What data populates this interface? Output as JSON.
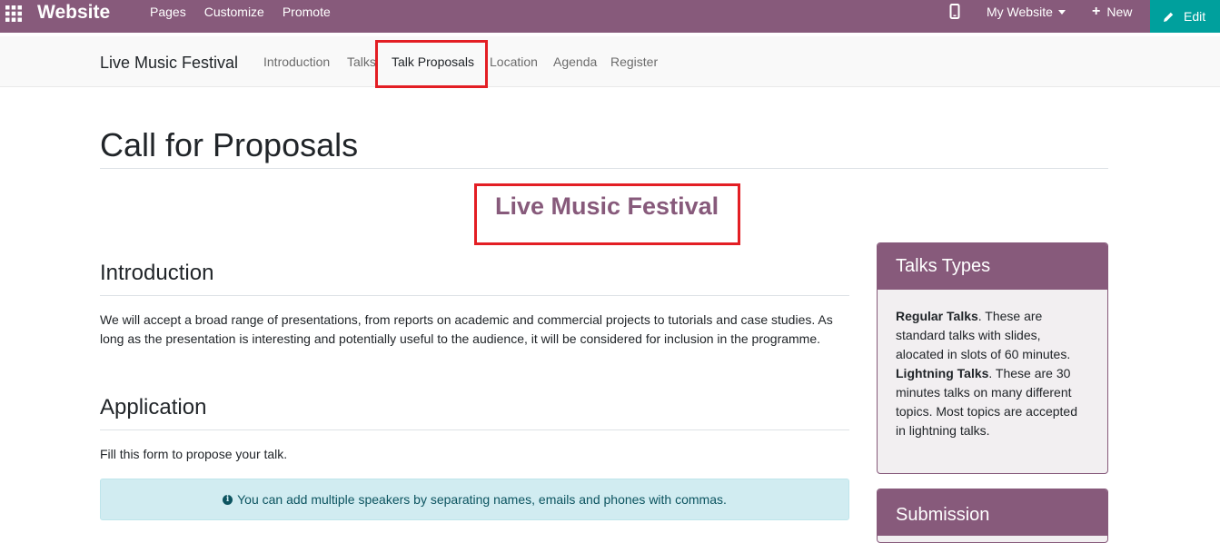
{
  "topbar": {
    "brand": "Website",
    "menu": [
      "Pages",
      "Customize",
      "Promote"
    ],
    "site_switch": "My Website",
    "new_label": "New",
    "edit_label": "Edit",
    "color": "#875a7b",
    "edit_color": "#00a09d",
    "icons": [
      "apps-grid-icon",
      "mobile-preview-icon",
      "plus-icon",
      "pencil-icon"
    ]
  },
  "event_nav": {
    "title": "Live Music Festival",
    "items": [
      "Introduction",
      "Talks",
      "Talk Proposals",
      "Location",
      "Agenda",
      "Register"
    ],
    "active": "Talk Proposals"
  },
  "main": {
    "title": "Call for Proposals",
    "subtitle": "Live Music Festival",
    "introduction": {
      "heading": "Introduction",
      "text": "We will accept a broad range of presentations, from reports on academic and commercial projects to tutorials and case studies. As long as the presentation is interesting and potentially useful to the audience, it will be considered for inclusion in the programme."
    },
    "application": {
      "heading": "Application",
      "text": "Fill this form to propose your talk."
    },
    "alert_text": "You can add multiple speakers by separating names, emails and phones with commas.",
    "alert_icon": "info-circle-icon"
  },
  "sidebar": {
    "talk_types": {
      "heading": "Talks Types",
      "regular_label": "Regular Talks",
      "regular_text": ". These are standard talks with slides, alocated in slots of 60 minutes.",
      "lightning_label": "Lightning Talks",
      "lightning_text": ". These are 30 minutes talks on many different topics. Most topics are accepted in lightning talks."
    },
    "submission": {
      "heading": "Submission"
    }
  },
  "colors": {
    "brand": "#875a7b",
    "highlight": "#e31e24",
    "alert_bg": "#d1ecf1",
    "alert_text": "#0c5460"
  }
}
